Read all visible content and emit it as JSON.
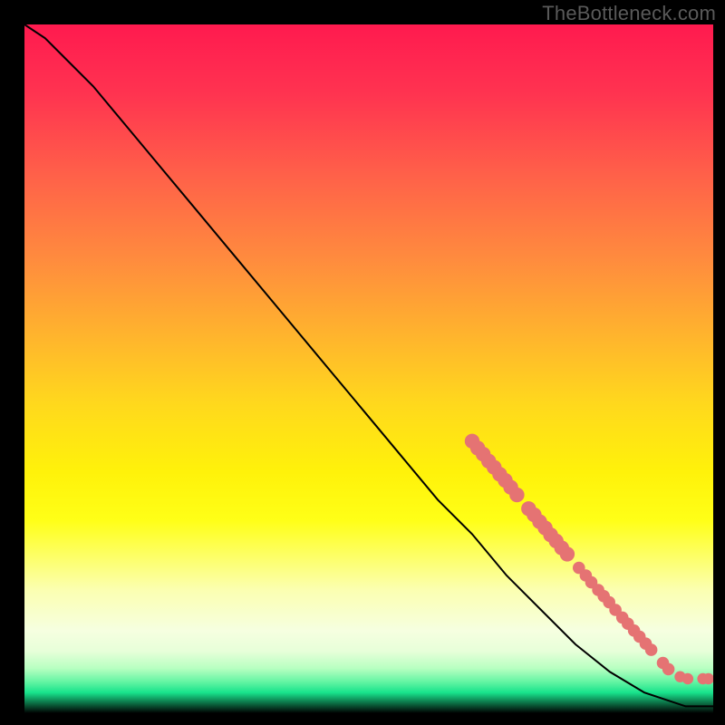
{
  "watermark": "TheBottleneck.com",
  "chart_data": {
    "type": "line",
    "title": "",
    "xlabel": "",
    "ylabel": "",
    "xlim": [
      0,
      100
    ],
    "ylim": [
      0,
      100
    ],
    "grid": false,
    "series": [
      {
        "name": "curve",
        "kind": "line",
        "x": [
          0,
          3,
          6,
          10,
          15,
          20,
          25,
          30,
          35,
          40,
          45,
          50,
          55,
          60,
          65,
          70,
          75,
          80,
          85,
          90,
          93,
          96,
          98,
          100
        ],
        "y": [
          100,
          98,
          95,
          91,
          85,
          79,
          73,
          67,
          61,
          55,
          49,
          43,
          37,
          31,
          26,
          20,
          15,
          10,
          6,
          3,
          2,
          1,
          1,
          1
        ]
      },
      {
        "name": "markers",
        "kind": "scatter",
        "points": [
          {
            "x": 65.0,
            "y": 39.5,
            "r": 1.2
          },
          {
            "x": 65.8,
            "y": 38.5,
            "r": 1.2
          },
          {
            "x": 66.6,
            "y": 37.6,
            "r": 1.2
          },
          {
            "x": 67.4,
            "y": 36.6,
            "r": 1.2
          },
          {
            "x": 68.2,
            "y": 35.7,
            "r": 1.2
          },
          {
            "x": 69.0,
            "y": 34.7,
            "r": 1.2
          },
          {
            "x": 69.8,
            "y": 33.8,
            "r": 1.2
          },
          {
            "x": 70.6,
            "y": 32.8,
            "r": 1.2
          },
          {
            "x": 71.5,
            "y": 31.7,
            "r": 1.2
          },
          {
            "x": 73.2,
            "y": 29.7,
            "r": 1.2
          },
          {
            "x": 74.0,
            "y": 28.8,
            "r": 1.2
          },
          {
            "x": 74.8,
            "y": 27.8,
            "r": 1.2
          },
          {
            "x": 75.6,
            "y": 26.9,
            "r": 1.2
          },
          {
            "x": 76.4,
            "y": 25.9,
            "r": 1.2
          },
          {
            "x": 77.2,
            "y": 25.0,
            "r": 1.2
          },
          {
            "x": 78.0,
            "y": 24.0,
            "r": 1.2
          },
          {
            "x": 78.8,
            "y": 23.1,
            "r": 1.2
          },
          {
            "x": 80.5,
            "y": 21.1,
            "r": 1.0
          },
          {
            "x": 81.5,
            "y": 20.0,
            "r": 1.0
          },
          {
            "x": 82.3,
            "y": 19.0,
            "r": 1.0
          },
          {
            "x": 83.3,
            "y": 17.9,
            "r": 1.0
          },
          {
            "x": 84.1,
            "y": 17.0,
            "r": 1.0
          },
          {
            "x": 84.9,
            "y": 16.1,
            "r": 1.0
          },
          {
            "x": 85.8,
            "y": 15.0,
            "r": 1.0
          },
          {
            "x": 86.8,
            "y": 13.9,
            "r": 1.0
          },
          {
            "x": 87.6,
            "y": 13.0,
            "r": 1.0
          },
          {
            "x": 88.5,
            "y": 12.0,
            "r": 1.0
          },
          {
            "x": 89.3,
            "y": 11.1,
            "r": 1.0
          },
          {
            "x": 90.2,
            "y": 10.1,
            "r": 1.0
          },
          {
            "x": 91.0,
            "y": 9.2,
            "r": 1.0
          },
          {
            "x": 92.7,
            "y": 7.3,
            "r": 1.0
          },
          {
            "x": 93.5,
            "y": 6.4,
            "r": 1.0
          },
          {
            "x": 95.2,
            "y": 5.3,
            "r": 0.9
          },
          {
            "x": 96.3,
            "y": 5.0,
            "r": 0.9
          },
          {
            "x": 98.5,
            "y": 5.0,
            "r": 0.9
          },
          {
            "x": 99.3,
            "y": 5.0,
            "r": 0.9
          }
        ]
      }
    ]
  },
  "gradient_stops": [
    {
      "offset": 0,
      "color": "#ff1a4f"
    },
    {
      "offset": 0.1,
      "color": "#ff3350"
    },
    {
      "offset": 0.22,
      "color": "#ff6149"
    },
    {
      "offset": 0.34,
      "color": "#ff8b3e"
    },
    {
      "offset": 0.46,
      "color": "#ffb72c"
    },
    {
      "offset": 0.55,
      "color": "#ffd81d"
    },
    {
      "offset": 0.65,
      "color": "#fff20a"
    },
    {
      "offset": 0.72,
      "color": "#ffff17"
    },
    {
      "offset": 0.82,
      "color": "#fbffb0"
    },
    {
      "offset": 0.88,
      "color": "#f6ffe0"
    },
    {
      "offset": 0.91,
      "color": "#e7ffd9"
    },
    {
      "offset": 0.935,
      "color": "#b7ffc1"
    },
    {
      "offset": 0.955,
      "color": "#61f4a2"
    },
    {
      "offset": 0.97,
      "color": "#18e38c"
    },
    {
      "offset": 1.0,
      "color": "#000000"
    }
  ]
}
